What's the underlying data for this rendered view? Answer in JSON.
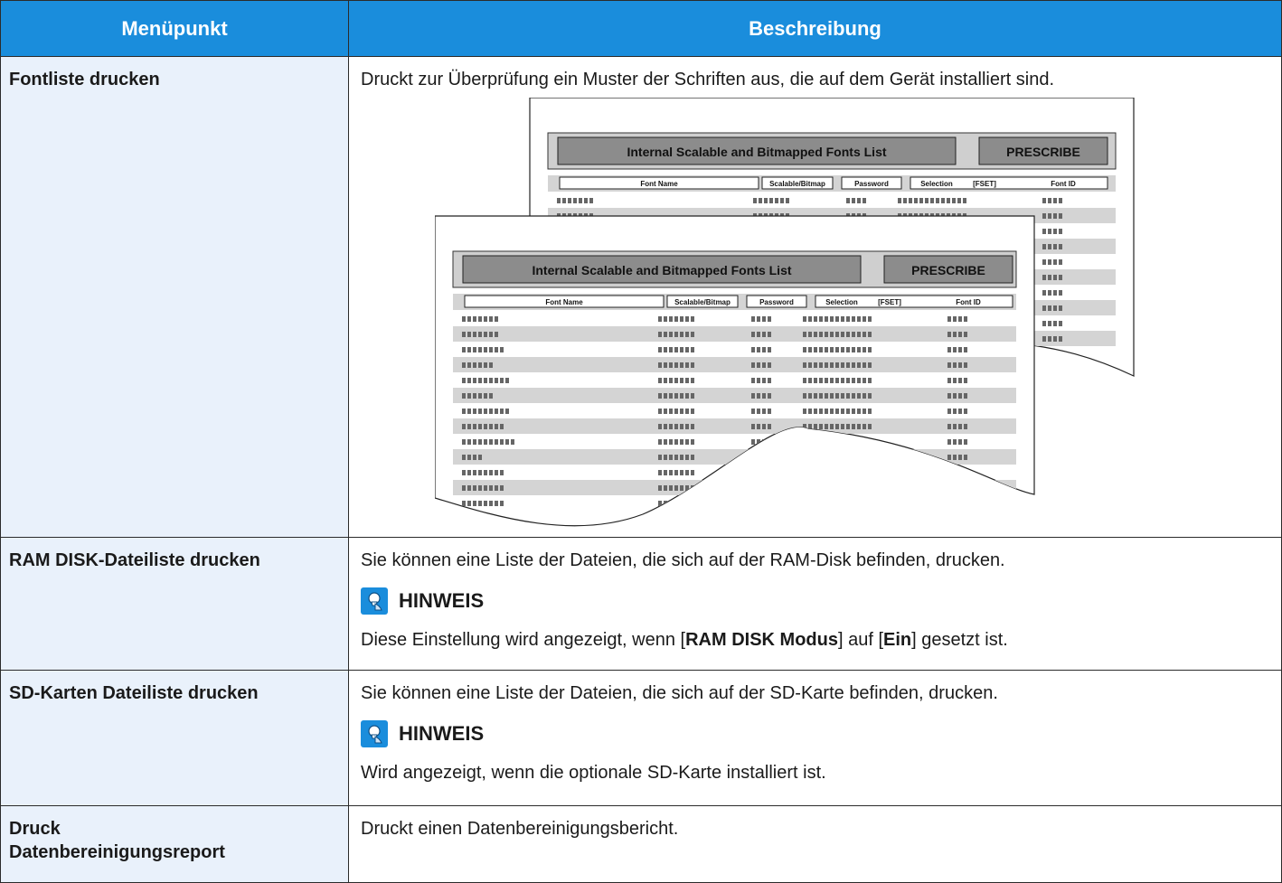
{
  "table": {
    "headers": {
      "item": "Menüpunkt",
      "description": "Beschreibung"
    },
    "rows": [
      {
        "item": "Fontliste drucken",
        "description": "Druckt zur Überprüfung ein Muster der Schriften aus, die auf dem Gerät installiert sind."
      },
      {
        "item": "RAM DISK-Dateiliste drucken",
        "description": "Sie können eine Liste der Dateien, die sich auf der RAM-Disk befinden, drucken.",
        "note_title": "HINWEIS",
        "note_pre": "Diese Einstellung wird angezeigt, wenn [",
        "note_b1": "RAM DISK Modus",
        "note_mid": "] auf [",
        "note_b2": "Ein",
        "note_post": "] gesetzt ist."
      },
      {
        "item": "SD-Karten Dateiliste drucken",
        "description": "Sie können eine Liste der Dateien, die sich auf der SD-Karte befinden, drucken.",
        "note_title": "HINWEIS",
        "note_text": "Wird angezeigt, wenn die optionale SD-Karte installiert ist."
      },
      {
        "item_line1": "Druck",
        "item_line2": "Datenbereinigungsreport",
        "description": "Druckt einen Datenbereinigungsbericht."
      }
    ]
  },
  "illustration": {
    "list_title": "Internal Scalable and Bitmapped Fonts List",
    "brand": "PRESCRIBE",
    "columns": [
      "Font Name",
      "Scalable/Bitmap",
      "Password",
      "Selection",
      "[FSET]",
      "Font ID"
    ],
    "colors": {
      "accent": "#1a8ddc",
      "stripe": "#d4d4d4",
      "header_box": "#8c8c8c"
    }
  },
  "icons": {
    "note": "lightbulb-hand-icon"
  }
}
